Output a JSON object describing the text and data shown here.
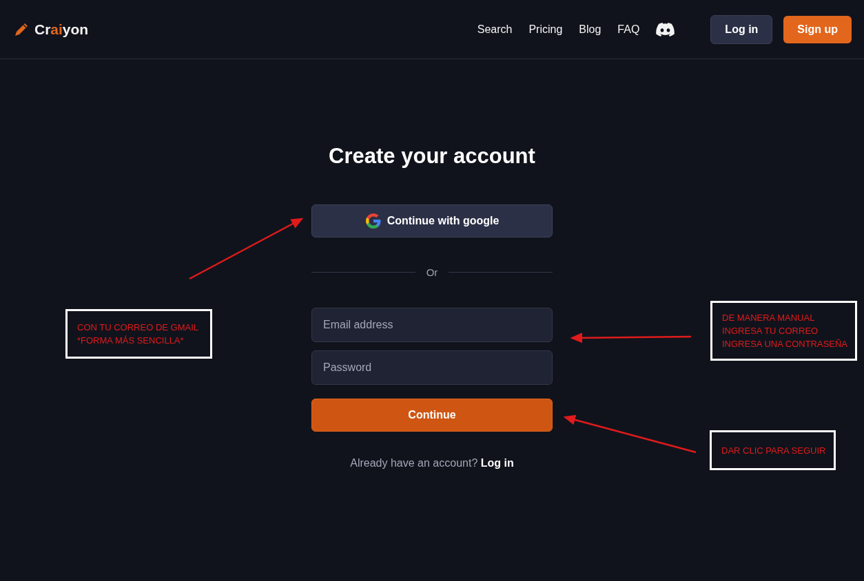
{
  "header": {
    "logo": [
      {
        "text": "Cr",
        "accent": false
      },
      {
        "text": "ai",
        "accent": true
      },
      {
        "text": "yon",
        "accent": false
      }
    ],
    "nav": [
      "Search",
      "Pricing",
      "Blog",
      "FAQ"
    ],
    "login": "Log in",
    "signup": "Sign up"
  },
  "form": {
    "title": "Create your account",
    "google_button": "Continue with google",
    "divider": "Or",
    "fields": [
      {
        "placeholder": "Email address"
      },
      {
        "placeholder": "Password"
      }
    ],
    "continue": "Continue",
    "footer_text": "Already have an account?",
    "footer_link": "Log in"
  },
  "annotations": [
    {
      "lines": [
        "CON TU CORREO DE GMAIL",
        "*FORMA MÁS SENCILLA*"
      ]
    },
    {
      "lines": [
        "DE MANERA MANUAL",
        "INGRESA TU CORREO",
        "INGRESA UNA CONTRASEÑA"
      ]
    },
    {
      "lines": [
        "DAR CLIC PARA SEGUIR"
      ]
    }
  ]
}
